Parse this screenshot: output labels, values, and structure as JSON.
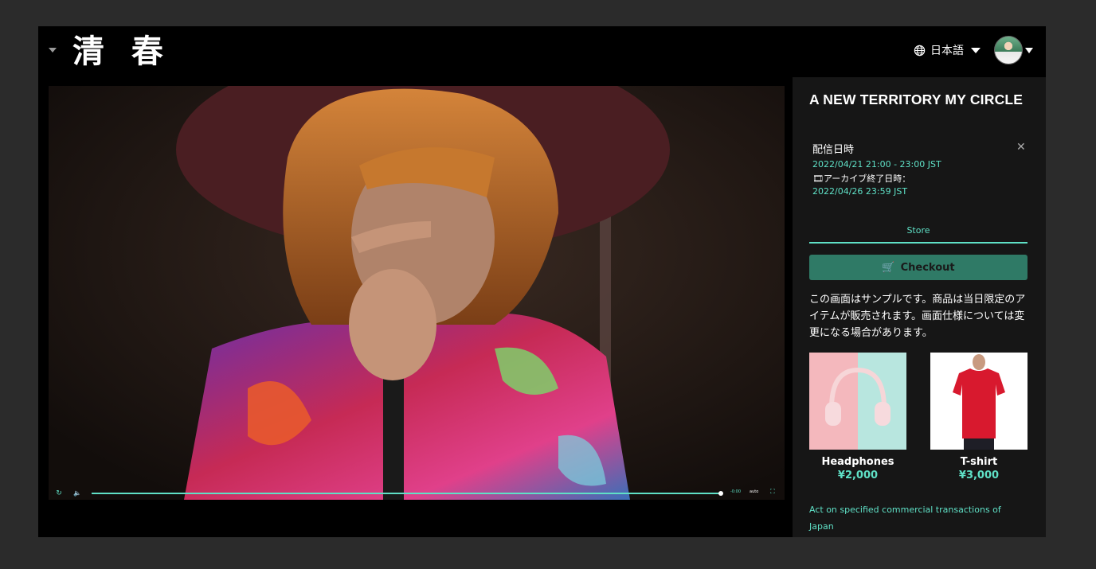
{
  "header": {
    "logo": "清 春",
    "language": "日本語",
    "globe_icon": "globe-icon",
    "avatar_icon": "user-avatar"
  },
  "player": {
    "time": "-0:00",
    "quality": "auto",
    "progress": 1.0,
    "replay_icon": "replay-icon",
    "volume_icon": "volume-icon",
    "fullscreen_icon": "fullscreen-icon"
  },
  "event": {
    "title": "A NEW TERRITORY MY CIRCLE",
    "schedule_label": "配信日時",
    "schedule_time": "2022/04/21 21:00 - 23:00 JST",
    "archive_label": "🎞アーカイブ終了日時：",
    "archive_time": "2022/04/26 23:59 JST"
  },
  "store": {
    "tab_label": "Store",
    "checkout_label": "Checkout",
    "description": "この画面はサンプルです。商品は当日限定のアイテムが販売されます。画面仕様については変更になる場合があります。",
    "products": [
      {
        "name": "Headphones",
        "price": "¥2,000"
      },
      {
        "name": "T-shirt",
        "price": "¥3,000"
      }
    ],
    "legal_link": "Act on specified commercial transactions of Japan"
  },
  "colors": {
    "accent": "#5fe0c6",
    "checkout_bg": "#2f7a66",
    "panel_bg": "#161616",
    "page_bg": "#2b2b2b"
  }
}
